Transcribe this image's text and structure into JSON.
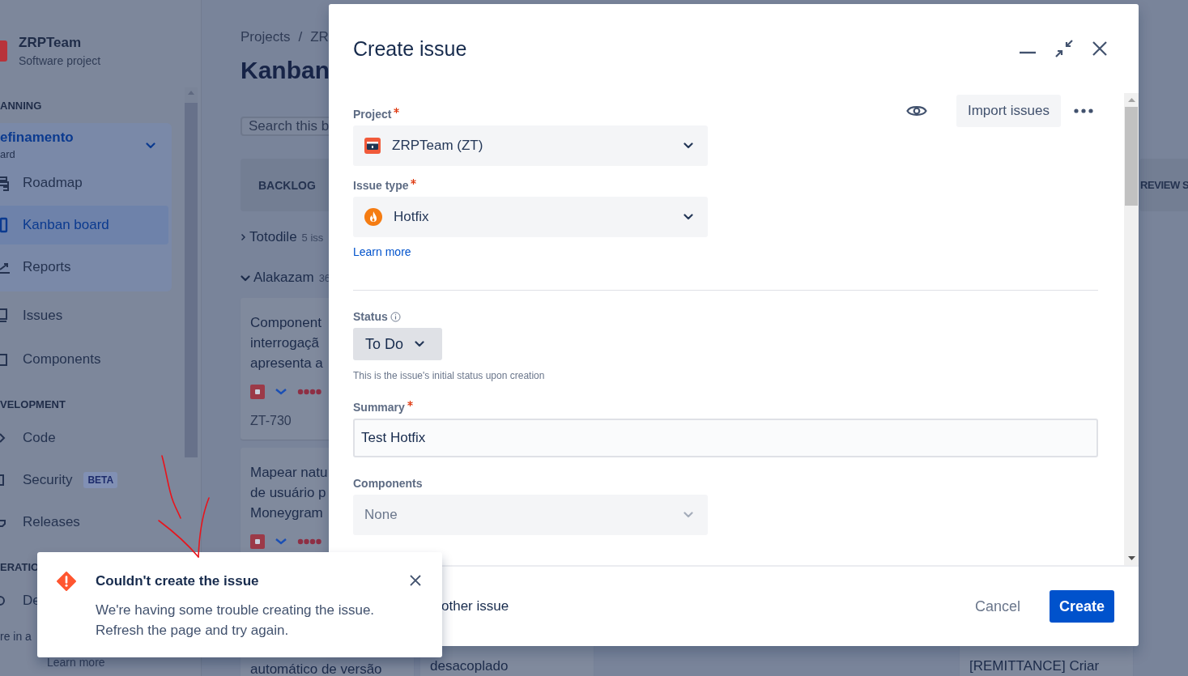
{
  "sidebar": {
    "project_name": "ZRPTeam",
    "project_type": "Software project",
    "planning_heading": "ANNING",
    "board": {
      "name": "efinamento",
      "subtitle": "ard",
      "expanded": true,
      "items": [
        {
          "label": "Roadmap",
          "selected": false
        },
        {
          "label": "Kanban board",
          "selected": true
        },
        {
          "label": "Reports",
          "selected": false
        }
      ]
    },
    "items": [
      {
        "label": "Issues",
        "selected": false
      },
      {
        "label": "Components",
        "selected": false
      }
    ],
    "development_heading": "VELOPMENT",
    "development_items": [
      {
        "label": "Code",
        "selected": false
      },
      {
        "label": "Security",
        "badge": "BETA",
        "selected": false
      },
      {
        "label": "Releases",
        "selected": false
      }
    ],
    "operations_heading": "ERATIO",
    "operations_items": [
      {
        "label": "De",
        "selected": false
      }
    ],
    "footer_text": "re in a",
    "footer_link": "Learn more"
  },
  "board": {
    "breadcrumb": [
      "Projects",
      "/",
      "ZR"
    ],
    "title": "Kanban",
    "search": {
      "placeholder": "Search this b"
    },
    "column_headers": [
      {
        "title": "BACKLOG"
      },
      {
        "title": "REVIEW S"
      }
    ],
    "swimlanes": [
      {
        "name": "Totodile",
        "count": "5 iss",
        "expanded": false
      },
      {
        "name": "Alakazam",
        "count": "36",
        "expanded": true
      }
    ],
    "lane_columns": [
      {
        "cards": [
          {
            "lines": [
              "Component",
              "interrogaçã",
              "apresenta a"
            ],
            "key": "ZT-730"
          },
          {
            "lines": [
              "Mapear natu",
              "de usuário p",
              "Moneygram"
            ]
          },
          {
            "lines": [
              "automático de versão"
            ]
          }
        ]
      },
      {
        "cards": [
          {
            "lines": [
              "desacoplado"
            ]
          }
        ]
      },
      {},
      {},
      {
        "cards": [
          {
            "lines": [
              "[REMITTANCE] Criar"
            ]
          }
        ]
      }
    ]
  },
  "dialog": {
    "title": "Create issue",
    "import_button": "Import issues",
    "top_fields": [
      {
        "kind": "select",
        "label": "Project",
        "required": true,
        "value": "ZRPTeam (ZT)"
      },
      {
        "kind": "select",
        "label": "Issue type",
        "required": true,
        "value": "Hotfix",
        "link": "Learn more"
      }
    ],
    "fields": [
      {
        "kind": "status",
        "label": "Status",
        "required": false,
        "value": "To Do",
        "help": "This is the issue's initial status upon creation"
      },
      {
        "kind": "text",
        "label": "Summary",
        "required": true,
        "value": "Test Hotfix"
      },
      {
        "kind": "select",
        "label": "Components",
        "required": false,
        "placeholder": "None"
      }
    ],
    "footer": {
      "checkbox_label": "other issue",
      "cancel": "Cancel",
      "submit": "Create"
    }
  },
  "toast": {
    "title": "Couldn't create the issue",
    "message": "We're having some trouble creating the issue. Refresh the page and try again."
  }
}
